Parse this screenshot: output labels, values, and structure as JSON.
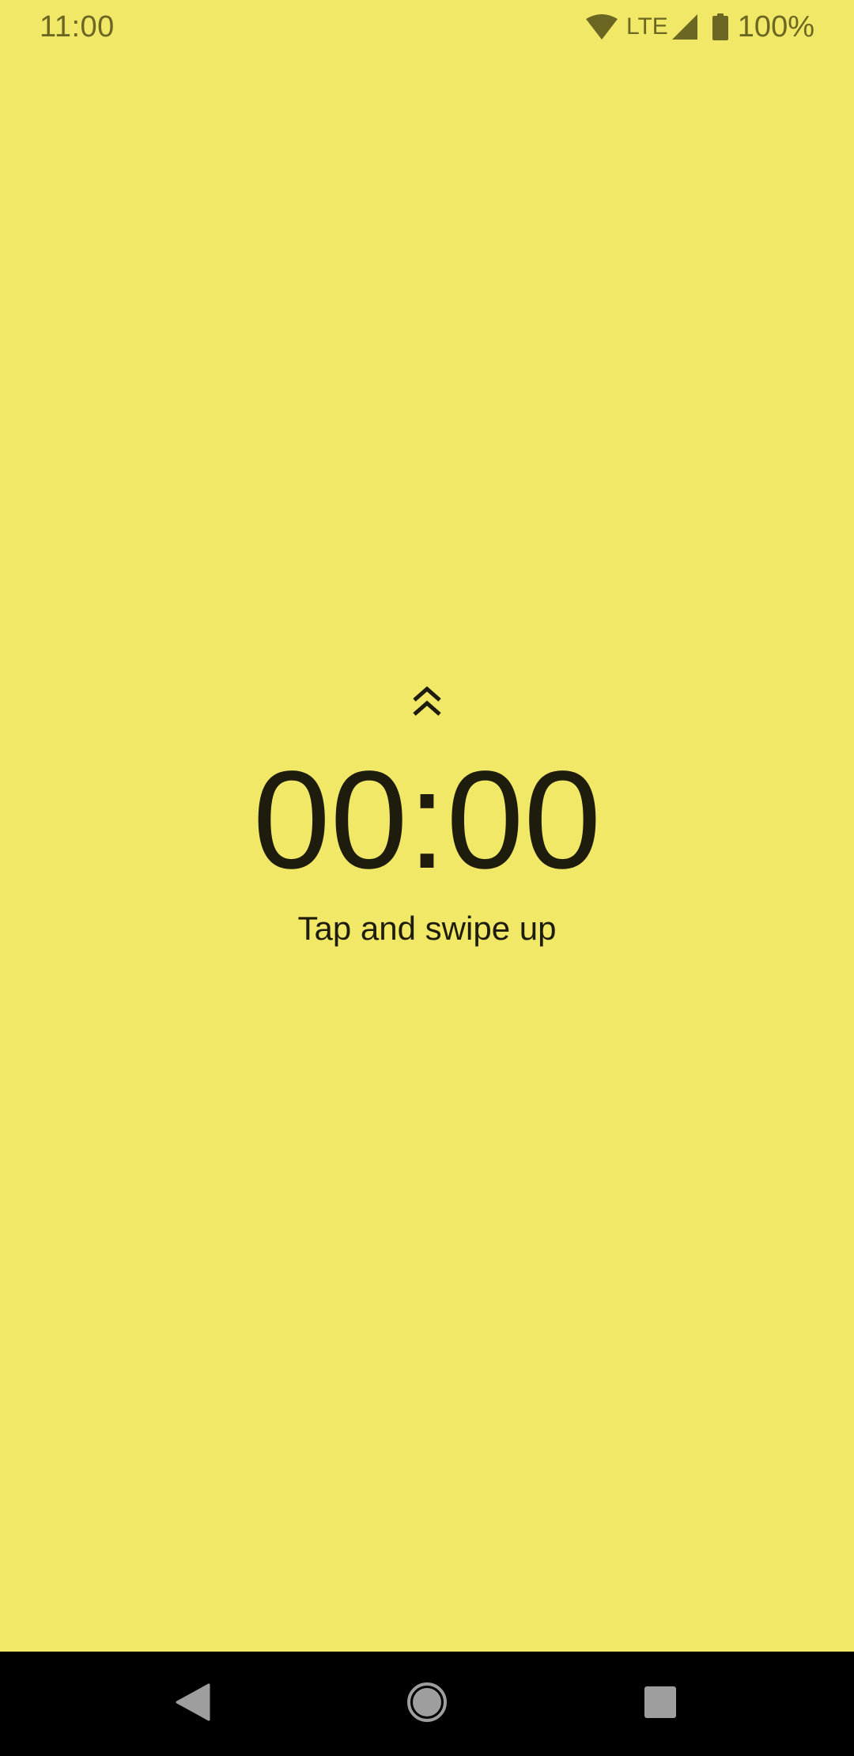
{
  "status_bar": {
    "time": "11:00",
    "network": "LTE",
    "battery": "100%",
    "icons": [
      "wifi-icon",
      "signal-icon",
      "battery-icon"
    ],
    "icon_color": "#6b6622"
  },
  "timer": {
    "value": "00:00",
    "hint": "Tap and swipe up",
    "swipe_icon": "double-chevron-up-icon"
  },
  "nav_bar": {
    "icons": [
      "back-icon",
      "home-icon",
      "recents-icon"
    ]
  },
  "colors": {
    "background": "#f1e868",
    "text": "#1e1c0c",
    "nav_background": "#000000",
    "nav_icon": "#9e9e9e"
  }
}
